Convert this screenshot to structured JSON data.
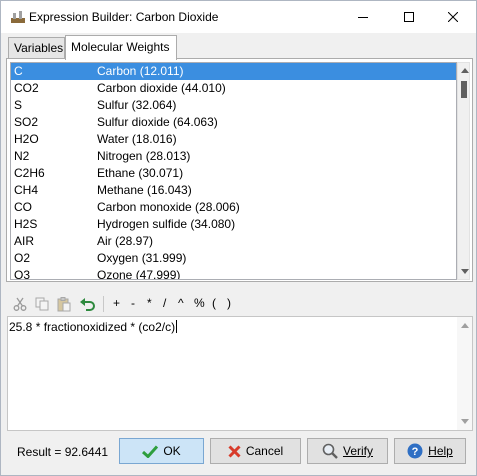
{
  "window": {
    "title": "Expression Builder: Carbon Dioxide"
  },
  "tabs": [
    {
      "label": "Variables",
      "active": false
    },
    {
      "label": "Molecular Weights",
      "active": true
    }
  ],
  "molecules": [
    {
      "formula": "C",
      "name": "Carbon (12.011)",
      "selected": true
    },
    {
      "formula": "CO2",
      "name": "Carbon dioxide (44.010)"
    },
    {
      "formula": "S",
      "name": "Sulfur (32.064)"
    },
    {
      "formula": "SO2",
      "name": "Sulfur dioxide (64.063)"
    },
    {
      "formula": "H2O",
      "name": "Water (18.016)"
    },
    {
      "formula": "N2",
      "name": "Nitrogen (28.013)"
    },
    {
      "formula": "C2H6",
      "name": "Ethane (30.071)"
    },
    {
      "formula": "CH4",
      "name": "Methane (16.043)"
    },
    {
      "formula": "CO",
      "name": "Carbon monoxide (28.006)"
    },
    {
      "formula": "H2S",
      "name": "Hydrogen sulfide (34.080)"
    },
    {
      "formula": "AIR",
      "name": "Air (28.97)"
    },
    {
      "formula": "O2",
      "name": "Oxygen (31.999)"
    },
    {
      "formula": "O3",
      "name": "Ozone (47.999)"
    }
  ],
  "toolbar": {
    "operators": [
      "+",
      "-",
      "*",
      "/",
      "^",
      "%",
      "(",
      ")"
    ]
  },
  "editor": {
    "expression": "25.8 * fractionoxidized * (co2/c)"
  },
  "footer": {
    "result": "Result = 92.6441",
    "ok_label": "OK",
    "cancel_label": "Cancel",
    "verify_label": "Verify",
    "help_label": "Help"
  },
  "colors": {
    "selection": "#3b8ee0",
    "ok_button": "#cce4f7",
    "cancel_icon": "#d83b2a",
    "ok_icon": "#2e9e3e",
    "help_icon": "#2f6fc4"
  }
}
